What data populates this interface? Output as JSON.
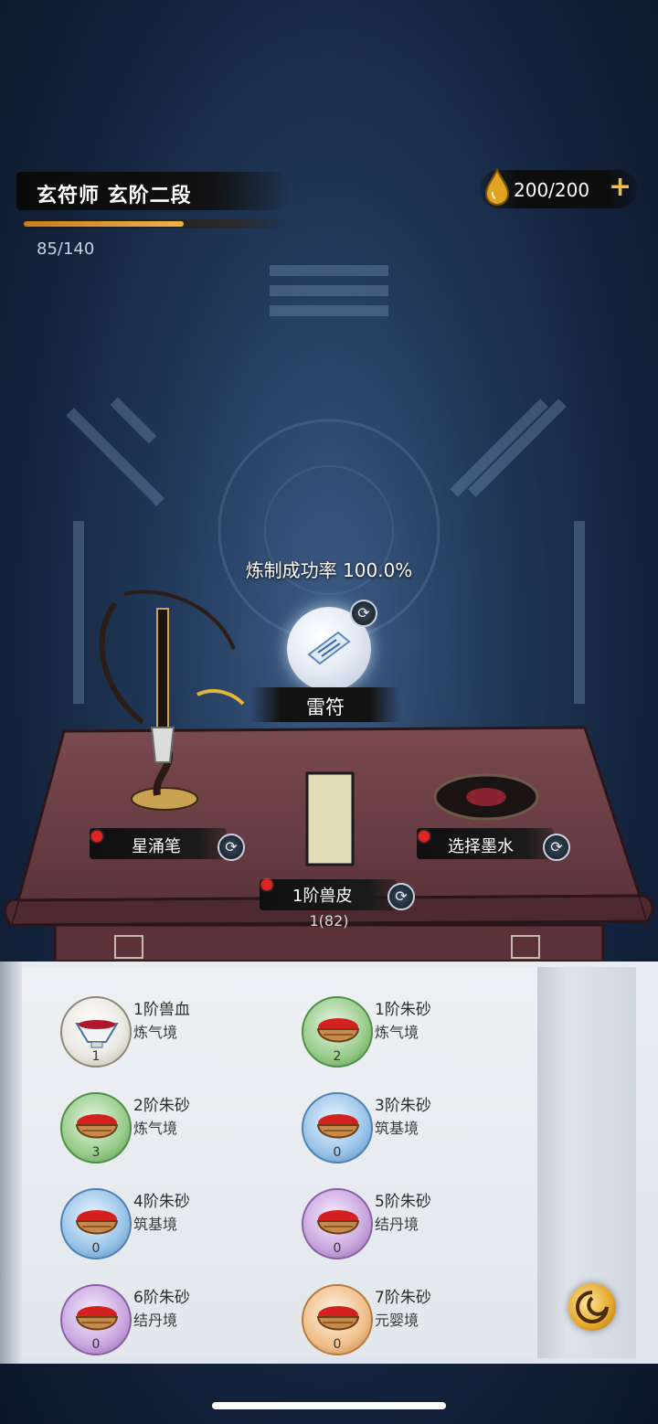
{
  "header": {
    "rank_title": "玄符师 玄阶二段",
    "exp_text": "85/140",
    "exp_progress": 0.607,
    "energy_text": "200/200",
    "energy_plus": "+"
  },
  "craft": {
    "success_rate_text": "炼制成功率 100.0%",
    "talisman_name": "雷符",
    "brush_label": "星涌笔",
    "ink_label": "选择墨水",
    "paper_label": "1阶兽皮",
    "paper_count": "1(82)"
  },
  "materials": [
    {
      "name": "1阶兽血",
      "realm": "炼气境",
      "count": "1",
      "orb": "white",
      "kind": "blood"
    },
    {
      "name": "1阶朱砂",
      "realm": "炼气境",
      "count": "2",
      "orb": "green",
      "kind": "cinnabar"
    },
    {
      "name": "2阶朱砂",
      "realm": "炼气境",
      "count": "3",
      "orb": "green",
      "kind": "cinnabar"
    },
    {
      "name": "3阶朱砂",
      "realm": "筑基境",
      "count": "0",
      "orb": "blue",
      "kind": "cinnabar"
    },
    {
      "name": "4阶朱砂",
      "realm": "筑基境",
      "count": "0",
      "orb": "blue",
      "kind": "cinnabar"
    },
    {
      "name": "5阶朱砂",
      "realm": "结丹境",
      "count": "0",
      "orb": "purple",
      "kind": "cinnabar"
    },
    {
      "name": "6阶朱砂",
      "realm": "结丹境",
      "count": "0",
      "orb": "purple",
      "kind": "cinnabar"
    },
    {
      "name": "7阶朱砂",
      "realm": "元婴境",
      "count": "0",
      "orb": "orange",
      "kind": "cinnabar"
    }
  ],
  "icons": {
    "energy": "oil-drop-icon",
    "refresh": "refresh-icon",
    "swirl": "swirl-icon"
  },
  "colors": {
    "exp_bar": "#e9a53a",
    "energy_plus": "#f3c23a",
    "red_dot": "#e02323",
    "desk": "#6e3f45"
  }
}
